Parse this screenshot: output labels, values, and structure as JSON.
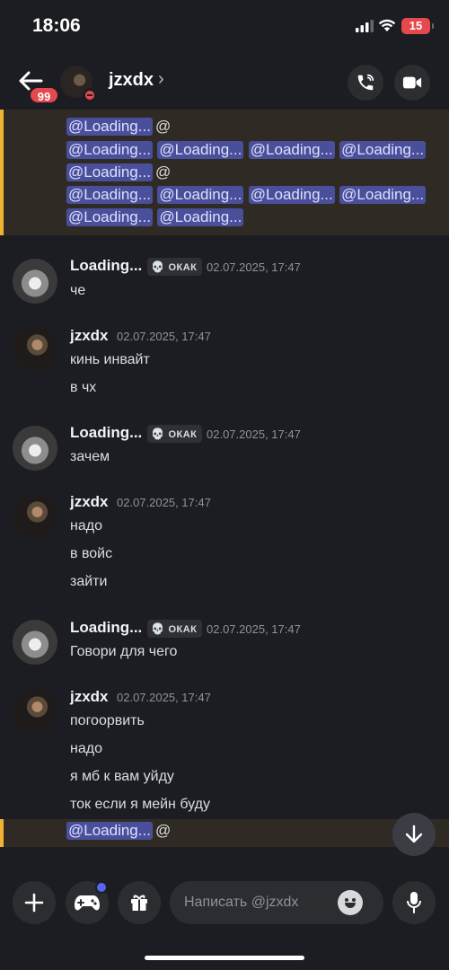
{
  "status": {
    "time": "18:06",
    "battery": "15"
  },
  "header": {
    "badge": "99",
    "name": "jzxdx",
    "chevron": "›"
  },
  "mentions": {
    "chip": "@Loading...",
    "at": "@"
  },
  "messages": [
    {
      "author": "Loading...",
      "tag": "ОКАК",
      "time": "02.07.2025, 17:47",
      "lines": [
        "че"
      ]
    },
    {
      "author": "jzxdx",
      "time": "02.07.2025, 17:47",
      "lines": [
        "кинь инвайт",
        "в чх"
      ]
    },
    {
      "author": "Loading...",
      "tag": "ОКАК",
      "time": "02.07.2025, 17:47",
      "lines": [
        "зачем"
      ]
    },
    {
      "author": "jzxdx",
      "time": "02.07.2025, 17:47",
      "lines": [
        "надо",
        "в войс",
        "зайти"
      ]
    },
    {
      "author": "Loading...",
      "tag": "ОКАК",
      "time": "02.07.2025, 17:47",
      "lines": [
        "Говори для чего"
      ]
    },
    {
      "author": "jzxdx",
      "time": "02.07.2025, 17:47",
      "lines": [
        "погоорвить",
        "надо",
        "я мб к вам уйду",
        "ток если я мейн буду"
      ]
    }
  ],
  "compose": {
    "placeholder": "Написать @jzxdx"
  },
  "icons": {
    "back": "arrow-left-icon",
    "call": "phone-icon",
    "video": "video-camera-icon",
    "plus": "plus-icon",
    "game": "gamepad-icon",
    "gift": "gift-icon",
    "emoji": "emoji-icon",
    "mic": "microphone-icon",
    "scroll": "arrow-down-icon",
    "tag": "skull-icon",
    "dnd": "do-not-disturb-icon"
  },
  "colors": {
    "accent": "#5865f2",
    "mention_bg": "#4a4f9c",
    "highlight_bar": "#f0b232",
    "danger": "#e5484d"
  }
}
